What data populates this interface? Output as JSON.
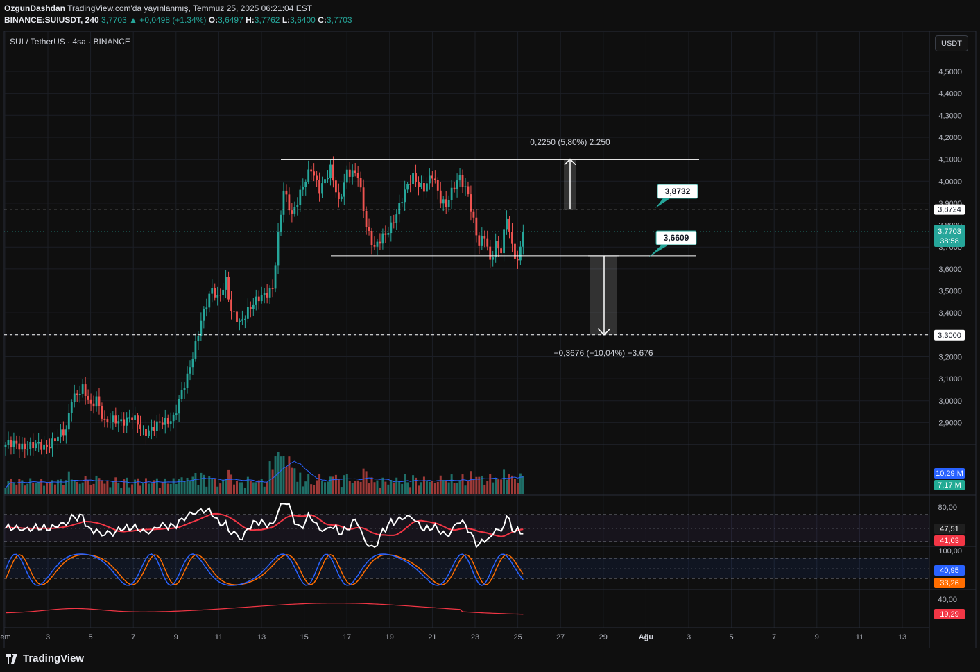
{
  "header": {
    "author": "OzgunDashdan",
    "published": "TradingView.com'da yayınlanmış, Temmuz 25, 2025 06:21:04 EST",
    "symbol": "BINANCE:SUIUSDT, 240",
    "last": "3,7703",
    "change": "▲ +0,0498 (+1.34%)",
    "o_label": "O:",
    "o": "3,6497",
    "h_label": "H:",
    "h": "3,7762",
    "l_label": "L:",
    "l": "3,6400",
    "c_label": "C:",
    "c": "3,7703"
  },
  "pane_title": "SUI / TetherUS · 4sa · BINANCE",
  "currency_button": "USDT",
  "brand": "TradingView",
  "colors": {
    "up": "#26a69a",
    "down": "#ef5350",
    "bg": "#0f0f0f",
    "grid": "#1c1f26",
    "text": "#b2b5be"
  },
  "chart_data": {
    "type": "candlestick",
    "price_axis": {
      "ticks": [
        "4,5000",
        "4,4000",
        "4,3000",
        "4,2000",
        "4,1000",
        "4,0000",
        "3,9000",
        "3,8000",
        "3,7000",
        "3,6000",
        "3,5000",
        "3,4000",
        "3,3000",
        "3,2000",
        "3,1000",
        "3,0000",
        "2,9000"
      ],
      "labels": [
        {
          "text": "3,8724",
          "value": 3.8724,
          "style": "level"
        },
        {
          "text": "3,7703",
          "value": 3.7703,
          "style": "last"
        },
        {
          "text": "38:58",
          "style": "countdown"
        },
        {
          "text": "3,3000",
          "value": 3.3,
          "style": "level"
        }
      ]
    },
    "time_axis": [
      "em",
      "3",
      "5",
      "7",
      "9",
      "11",
      "13",
      "15",
      "17",
      "19",
      "21",
      "23",
      "25",
      "27",
      "29",
      "Ağu",
      "3",
      "5",
      "7",
      "9",
      "11",
      "13"
    ],
    "price_path": [
      [
        0,
        2.8
      ],
      [
        14,
        2.79
      ],
      [
        22,
        2.86
      ],
      [
        24,
        3.02
      ],
      [
        28,
        3.05
      ],
      [
        31,
        2.97
      ],
      [
        33,
        3.02
      ],
      [
        36,
        2.9
      ],
      [
        46,
        2.92
      ],
      [
        50,
        2.86
      ],
      [
        58,
        2.9
      ],
      [
        61,
        2.93
      ],
      [
        66,
        3.1
      ],
      [
        71,
        3.37
      ],
      [
        75,
        3.5
      ],
      [
        77,
        3.47
      ],
      [
        80,
        3.55
      ],
      [
        82,
        3.4
      ],
      [
        85,
        3.35
      ],
      [
        88,
        3.42
      ],
      [
        94,
        3.48
      ],
      [
        97,
        3.52
      ],
      [
        99,
        3.75
      ],
      [
        101,
        3.95
      ],
      [
        104,
        3.85
      ],
      [
        107,
        3.95
      ],
      [
        111,
        4.05
      ],
      [
        114,
        3.97
      ],
      [
        118,
        4.05
      ],
      [
        121,
        3.9
      ],
      [
        124,
        4.05
      ],
      [
        128,
        4.02
      ],
      [
        131,
        3.8
      ],
      [
        134,
        3.7
      ],
      [
        138,
        3.75
      ],
      [
        140,
        3.8
      ],
      [
        144,
        3.92
      ],
      [
        148,
        4.02
      ],
      [
        152,
        3.97
      ],
      [
        155,
        4.02
      ],
      [
        158,
        3.92
      ],
      [
        160,
        3.9
      ],
      [
        162,
        3.95
      ],
      [
        165,
        4.01
      ],
      [
        168,
        3.95
      ],
      [
        170,
        3.82
      ],
      [
        172,
        3.7
      ],
      [
        174,
        3.75
      ],
      [
        176,
        3.64
      ],
      [
        178,
        3.72
      ],
      [
        180,
        3.68
      ],
      [
        182,
        3.83
      ],
      [
        184,
        3.7
      ],
      [
        186,
        3.64
      ],
      [
        188,
        3.77
      ]
    ],
    "volume_axis": {
      "labels": [
        {
          "text": "10,29 M",
          "series": "volume"
        },
        {
          "text": "7,17 M",
          "series": "volume-ma"
        }
      ]
    },
    "rsi": {
      "ticks": [
        "80,00"
      ],
      "labels": [
        {
          "text": "47,51",
          "series": "rsi"
        },
        {
          "text": "41,03",
          "series": "rsi-ma"
        }
      ]
    },
    "stoch": {
      "ticks": [
        "100,00"
      ],
      "labels": [
        {
          "text": "40,95",
          "series": "k"
        },
        {
          "text": "33,26",
          "series": "d"
        }
      ]
    },
    "bottom_indicator": {
      "ticks": [
        "40,00"
      ],
      "labels": [
        {
          "text": "19,29",
          "series": "line"
        }
      ]
    },
    "drawings": {
      "levels": [
        4.1,
        3.66
      ],
      "dashed_levels": [
        3.8724,
        3.3
      ],
      "measure_up": {
        "text": "0,2250 (5,80%) 2.250",
        "from": 3.8724,
        "to": 4.1
      },
      "measure_down": {
        "text": "−0,3676 (−10,04%) −3.676",
        "from": 3.66,
        "to": 3.3
      },
      "callouts": [
        {
          "text": "3,8732",
          "value": 3.8732
        },
        {
          "text": "3,6609",
          "value": 3.6609
        }
      ]
    }
  }
}
